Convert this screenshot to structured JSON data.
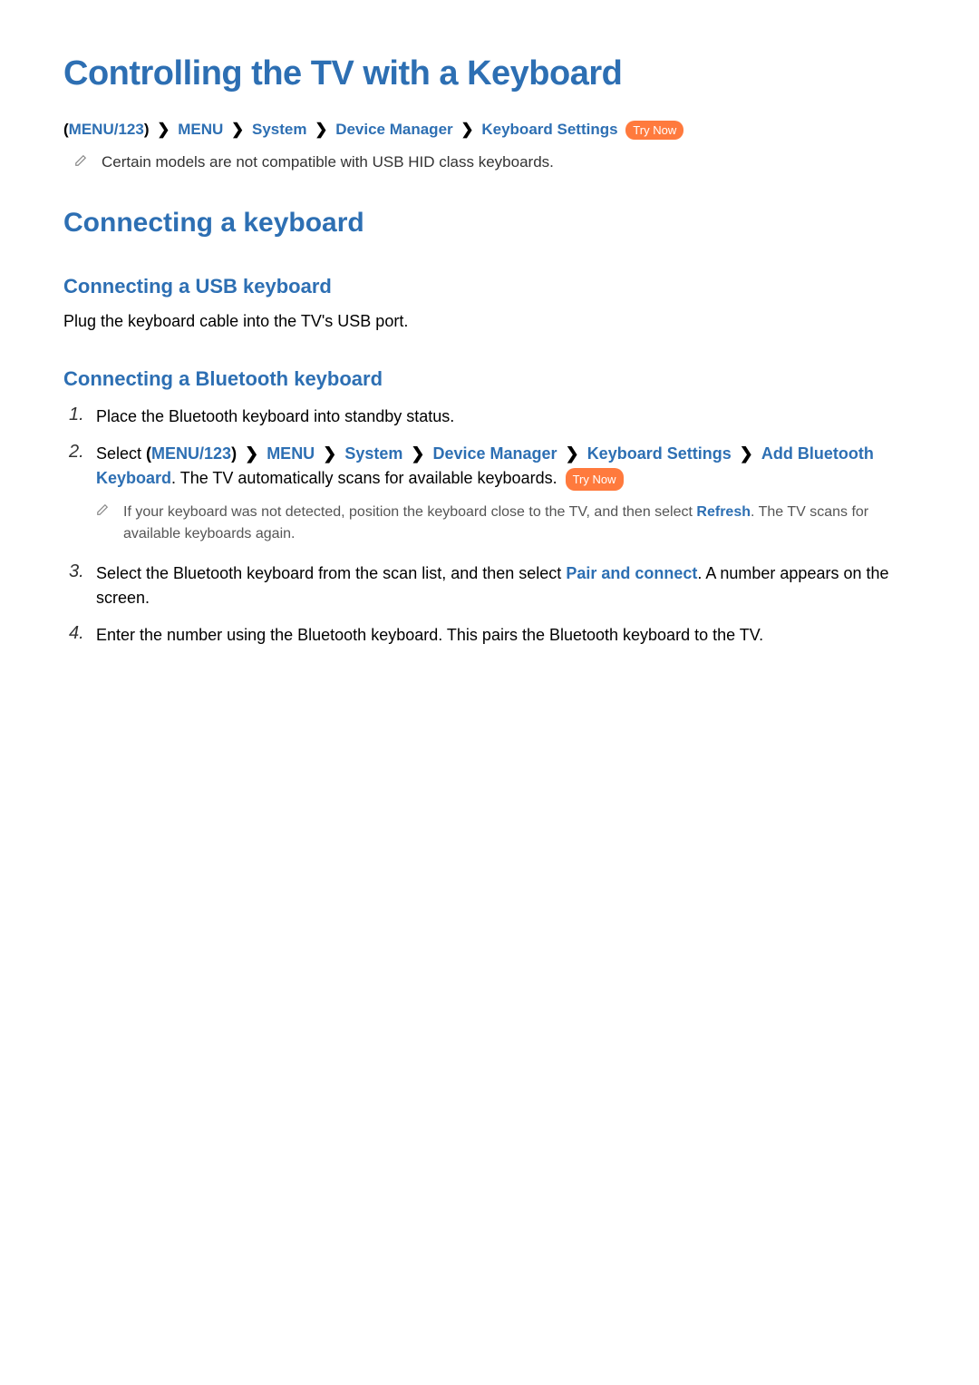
{
  "page": {
    "title": "Controlling the TV with a Keyboard"
  },
  "breadcrumb1": {
    "paren_open": "(",
    "paren_close": ")",
    "item1": "MENU/123",
    "item2": "MENU",
    "item3": "System",
    "item4": "Device Manager",
    "item5": "Keyboard Settings",
    "try_now": "Try Now"
  },
  "note1": {
    "text": "Certain models are not compatible with USB HID class keyboards."
  },
  "section1": {
    "title": "Connecting a keyboard"
  },
  "sub1": {
    "title": "Connecting a USB keyboard",
    "body": "Plug the keyboard cable into the TV's USB port."
  },
  "sub2": {
    "title": "Connecting a Bluetooth keyboard"
  },
  "steps": {
    "s1_num": "1.",
    "s1_text": "Place the Bluetooth keyboard into standby status.",
    "s2_num": "2.",
    "s2_prefix": "Select ",
    "s2_suffix": ". The TV automatically scans for available keyboards. ",
    "s2_try_now": "Try Now",
    "s2_bc": {
      "paren_open": "(",
      "paren_close": ")",
      "item1": "MENU/123",
      "item2": "MENU",
      "item3": "System",
      "item4": "Device Manager",
      "item5": "Keyboard Settings",
      "item6": "Add Bluetooth Keyboard"
    },
    "s2_note_a": "If your keyboard was not detected, position the keyboard close to the TV, and then select ",
    "s2_note_refresh": "Refresh",
    "s2_note_b": ". The TV scans for available keyboards again.",
    "s3_num": "3.",
    "s3_a": "Select the Bluetooth keyboard from the scan list, and then select ",
    "s3_pair": "Pair and connect",
    "s3_b": ". A number appears on the screen.",
    "s4_num": "4.",
    "s4_text": "Enter the number using the Bluetooth keyboard. This pairs the Bluetooth keyboard to the TV."
  }
}
